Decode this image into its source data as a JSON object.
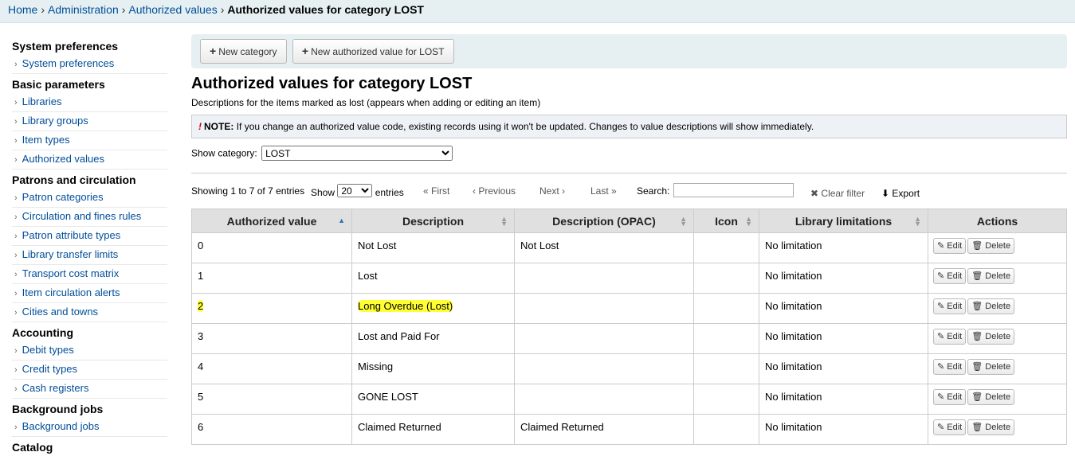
{
  "breadcrumbs": {
    "home": "Home",
    "admin": "Administration",
    "av": "Authorized values",
    "current": "Authorized values for category LOST"
  },
  "sidebar": [
    {
      "heading": "System preferences",
      "items": [
        "System preferences"
      ]
    },
    {
      "heading": "Basic parameters",
      "items": [
        "Libraries",
        "Library groups",
        "Item types",
        "Authorized values"
      ]
    },
    {
      "heading": "Patrons and circulation",
      "items": [
        "Patron categories",
        "Circulation and fines rules",
        "Patron attribute types",
        "Library transfer limits",
        "Transport cost matrix",
        "Item circulation alerts",
        "Cities and towns"
      ]
    },
    {
      "heading": "Accounting",
      "items": [
        "Debit types",
        "Credit types",
        "Cash registers"
      ]
    },
    {
      "heading": "Background jobs",
      "items": [
        "Background jobs"
      ]
    },
    {
      "heading": "Catalog",
      "items": []
    }
  ],
  "toolbar": {
    "new_category": "New category",
    "new_value": "New authorized value for LOST"
  },
  "page_title": "Authorized values for category LOST",
  "description": "Descriptions for the items marked as lost (appears when adding or editing an item)",
  "note": {
    "label": "NOTE:",
    "text": "If you change an authorized value code, existing records using it won't be updated. Changes to value descriptions will show immediately."
  },
  "show_category": {
    "label": "Show category:",
    "value": "LOST"
  },
  "datatable": {
    "info": "Showing 1 to 7 of 7 entries",
    "show": "Show",
    "page_size": "20",
    "entries": "entries",
    "first": "« First",
    "previous": "‹ Previous",
    "next": "Next ›",
    "last": "Last »",
    "search": "Search:",
    "clear_filter": "Clear filter",
    "export": "Export"
  },
  "columns": [
    "Authorized value",
    "Description",
    "Description (OPAC)",
    "Icon",
    "Library limitations",
    "Actions"
  ],
  "rows": [
    {
      "value": "0",
      "description": "Not Lost",
      "opac": "Not Lost",
      "icon": "",
      "limitation": "No limitation",
      "highlight": false
    },
    {
      "value": "1",
      "description": "Lost",
      "opac": "",
      "icon": "",
      "limitation": "No limitation",
      "highlight": false
    },
    {
      "value": "2",
      "description": "Long Overdue (Lost)",
      "opac": "",
      "icon": "",
      "limitation": "No limitation",
      "highlight": true
    },
    {
      "value": "3",
      "description": "Lost and Paid For",
      "opac": "",
      "icon": "",
      "limitation": "No limitation",
      "highlight": false
    },
    {
      "value": "4",
      "description": "Missing",
      "opac": "",
      "icon": "",
      "limitation": "No limitation",
      "highlight": false
    },
    {
      "value": "5",
      "description": "GONE LOST",
      "opac": "",
      "icon": "",
      "limitation": "No limitation",
      "highlight": false
    },
    {
      "value": "6",
      "description": "Claimed Returned",
      "opac": "Claimed Returned",
      "icon": "",
      "limitation": "No limitation",
      "highlight": false
    }
  ],
  "row_actions": {
    "edit": "Edit",
    "delete": "Delete"
  },
  "colors": {
    "link": "#004d99",
    "toolbar_bg": "#e6f0f2",
    "highlight": "#ffff33"
  }
}
